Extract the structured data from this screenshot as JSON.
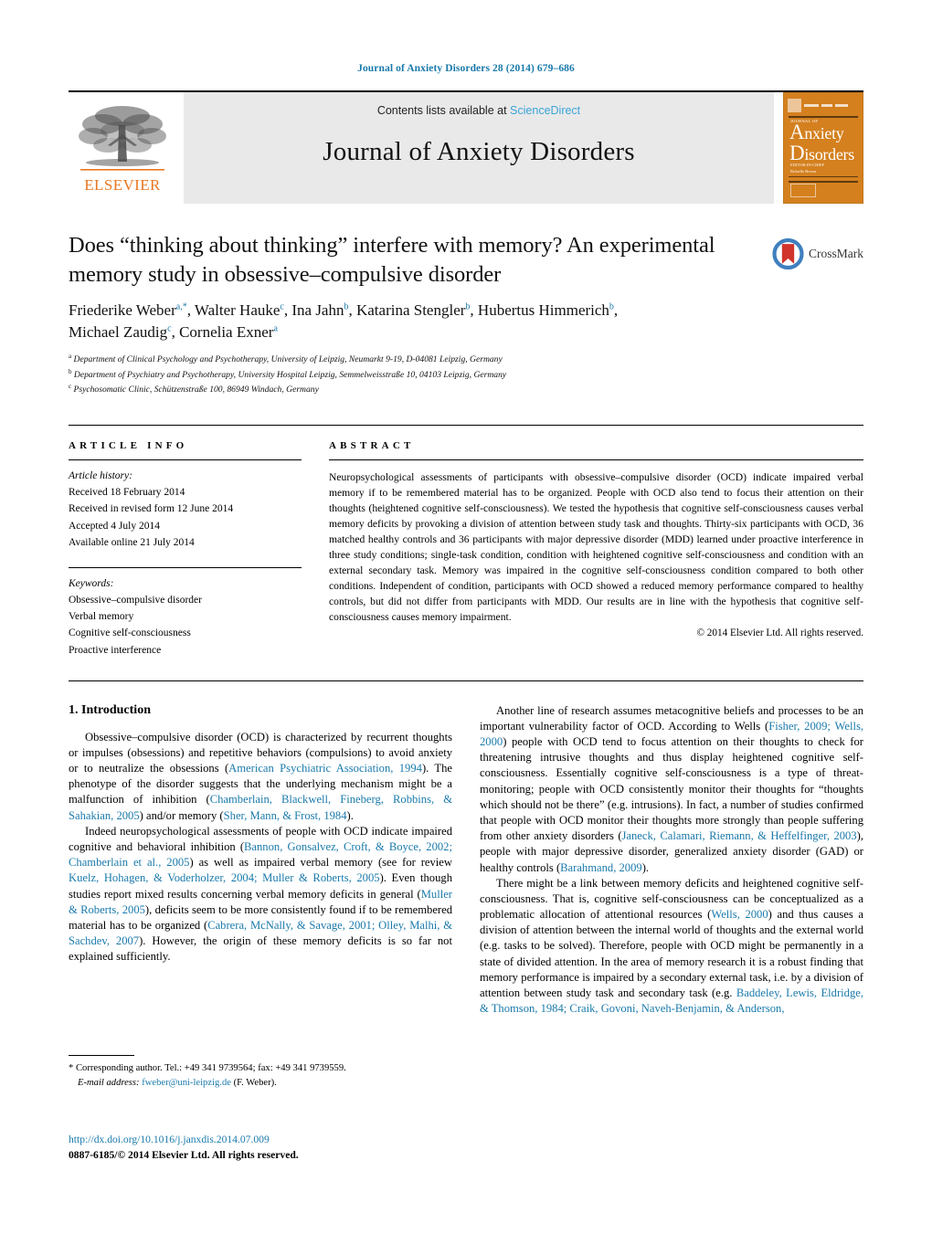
{
  "running_head": "Journal of Anxiety Disorders 28 (2014) 679–686",
  "masthead": {
    "publisher_name": "ELSEVIER",
    "contents_prefix": "Contents lists available at",
    "sciencedirect": "ScienceDirect",
    "journal_title": "Journal of Anxiety Disorders",
    "cover": {
      "journal_of": "JOURNAL OF",
      "line1_cap": "A",
      "line1_rest": "nxiety",
      "line2_cap": "D",
      "line2_rest": "isorders",
      "editors": "EDITOR-IN-CHIEF\nRic helle Brown"
    }
  },
  "article": {
    "title": "Does “thinking about thinking” interfere with memory? An experimental memory study in obsessive–compulsive disorder",
    "authors_line1": "Friederike Weber",
    "authors": [
      {
        "name": "Friederike Weber",
        "sup": "a,*"
      },
      {
        "name": "Walter Hauke",
        "sup": "c"
      },
      {
        "name": "Ina Jahn",
        "sup": "b"
      },
      {
        "name": "Katarina Stengler",
        "sup": "b"
      },
      {
        "name": "Hubertus Himmerich",
        "sup": "b"
      },
      {
        "name": "Michael Zaudig",
        "sup": "c"
      },
      {
        "name": "Cornelia Exner",
        "sup": "a"
      }
    ],
    "affiliations": [
      {
        "sup": "a",
        "text": "Department of Clinical Psychology and Psychotherapy, University of Leipzig, Neumarkt 9-19, D-04081 Leipzig, Germany"
      },
      {
        "sup": "b",
        "text": "Department of Psychiatry and Psychotherapy, University Hospital Leipzig, Semmelweisstraße 10, 04103 Leipzig, Germany"
      },
      {
        "sup": "c",
        "text": "Psychosomatic Clinic, Schützenstraße 100, 86949 Windach, Germany"
      }
    ],
    "crossmark_label": "CrossMark"
  },
  "info": {
    "heading": "ARTICLE INFO",
    "history_label": "Article history:",
    "history": [
      "Received 18 February 2014",
      "Received in revised form 12 June 2014",
      "Accepted 4 July 2014",
      "Available online 21 July 2014"
    ],
    "keywords_label": "Keywords:",
    "keywords": [
      "Obsessive–compulsive disorder",
      "Verbal memory",
      "Cognitive self-consciousness",
      "Proactive interference"
    ]
  },
  "abstract": {
    "heading": "ABSTRACT",
    "text": "Neuropsychological assessments of participants with obsessive–compulsive disorder (OCD) indicate impaired verbal memory if to be remembered material has to be organized. People with OCD also tend to focus their attention on their thoughts (heightened cognitive self-consciousness). We tested the hypothesis that cognitive self-consciousness causes verbal memory deficits by provoking a division of attention between study task and thoughts. Thirty-six participants with OCD, 36 matched healthy controls and 36 participants with major depressive disorder (MDD) learned under proactive interference in three study conditions; single-task condition, condition with heightened cognitive self-consciousness and condition with an external secondary task. Memory was impaired in the cognitive self-consciousness condition compared to both other conditions. Independent of condition, participants with OCD showed a reduced memory performance compared to healthy controls, but did not differ from participants with MDD. Our results are in line with the hypothesis that cognitive self-consciousness causes memory impairment.",
    "copyright": "© 2014 Elsevier Ltd. All rights reserved."
  },
  "body": {
    "section_number_title": "1. Introduction",
    "left_paragraphs": [
      {
        "runs": [
          {
            "t": "Obsessive–compulsive disorder (OCD) is characterized by recurrent thoughts or impulses (obsessions) and repetitive behaviors (compulsions) to avoid anxiety or to neutralize the obsessions ("
          },
          {
            "t": "American Psychiatric Association, 1994",
            "cite": true
          },
          {
            "t": "). The phenotype of the disorder suggests that the underlying mechanism might be a malfunction of inhibition ("
          },
          {
            "t": "Chamberlain, Blackwell, Fineberg, Robbins, & Sahakian, 2005",
            "cite": true
          },
          {
            "t": ") and/or memory ("
          },
          {
            "t": "Sher, Mann, & Frost, 1984",
            "cite": true
          },
          {
            "t": ")."
          }
        ]
      },
      {
        "runs": [
          {
            "t": "Indeed neuropsychological assessments of people with OCD indicate impaired cognitive and behavioral inhibition ("
          },
          {
            "t": "Bannon, Gonsalvez, Croft, & Boyce, 2002; Chamberlain et al., 2005",
            "cite": true
          },
          {
            "t": ") as well as impaired verbal memory (see for review "
          },
          {
            "t": "Kuelz, Hohagen, & Voderholzer, 2004; Muller & Roberts, 2005",
            "cite": true
          },
          {
            "t": "). Even though studies report mixed results concerning verbal memory deficits in general ("
          },
          {
            "t": "Muller & Roberts, 2005",
            "cite": true
          },
          {
            "t": "), deficits seem to be more consistently found if to be remembered material has to be organized ("
          },
          {
            "t": "Cabrera, McNally, & Savage, 2001; Olley, Malhi, & Sachdev, 2007",
            "cite": true
          },
          {
            "t": "). However, the origin of these memory deficits is so far not explained sufficiently."
          }
        ]
      }
    ],
    "right_paragraphs": [
      {
        "runs": [
          {
            "t": "Another line of research assumes metacognitive beliefs and processes to be an important vulnerability factor of OCD. According to Wells ("
          },
          {
            "t": "Fisher, 2009; Wells, 2000",
            "cite": true
          },
          {
            "t": ") people with OCD tend to focus attention on their thoughts to check for threatening intrusive thoughts and thus display heightened cognitive self-consciousness. Essentially cognitive self-consciousness is a type of threat-monitoring; people with OCD consistently monitor their thoughts for “thoughts which should not be there” (e.g. intrusions). In fact, a number of studies confirmed that people with OCD monitor their thoughts more strongly than people suffering from other anxiety disorders ("
          },
          {
            "t": "Janeck, Calamari, Riemann, & Heffelfinger, 2003",
            "cite": true
          },
          {
            "t": "), people with major depressive disorder, generalized anxiety disorder (GAD) or healthy controls ("
          },
          {
            "t": "Barahmand, 2009",
            "cite": true
          },
          {
            "t": ")."
          }
        ]
      },
      {
        "runs": [
          {
            "t": "There might be a link between memory deficits and heightened cognitive self-consciousness. That is, cognitive self-consciousness can be conceptualized as a problematic allocation of attentional resources ("
          },
          {
            "t": "Wells, 2000",
            "cite": true
          },
          {
            "t": ") and thus causes a division of attention between the internal world of thoughts and the external world (e.g. tasks to be solved). Therefore, people with OCD might be permanently in a state of divided attention. In the area of memory research it is a robust finding that memory performance is impaired by a secondary external task, i.e. by a division of attention between study task and secondary task (e.g. "
          },
          {
            "t": "Baddeley, Lewis, Eldridge, & Thomson, 1984; Craik, Govoni, Naveh-Benjamin, & Anderson,",
            "cite": true
          }
        ]
      }
    ]
  },
  "footnote": {
    "marker": "*",
    "line1": "Corresponding author. Tel.: +49 341 9739564; fax: +49 341 9739559.",
    "email_label": "E-mail address:",
    "email": "fweber@uni-leipzig.de",
    "email_suffix": "(F. Weber)."
  },
  "footer": {
    "doi": "http://dx.doi.org/10.1016/j.janxdis.2014.07.009",
    "issn_line": "0887-6185/© 2014 Elsevier Ltd. All rights reserved."
  },
  "colors": {
    "link": "#1a7aab",
    "sciencedirect": "#3ba4da",
    "elsevier_orange": "#e87722",
    "cover_orange": "#d4801f"
  }
}
